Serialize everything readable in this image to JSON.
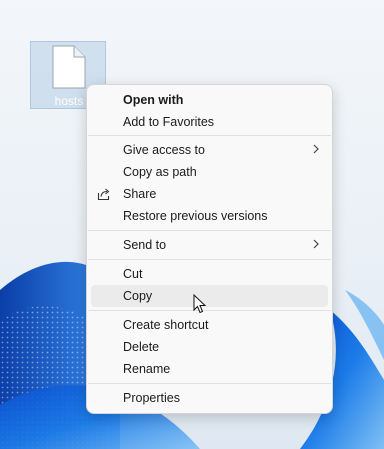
{
  "desktop": {
    "file": {
      "name": "hosts",
      "icon": "document-icon"
    }
  },
  "context_menu": {
    "items": [
      {
        "label": "Open with",
        "bold": true
      },
      {
        "label": "Add to Favorites"
      },
      {
        "label": "Give access to",
        "submenu": true
      },
      {
        "label": "Copy as path"
      },
      {
        "label": "Share",
        "icon": "share-icon"
      },
      {
        "label": "Restore previous versions"
      },
      {
        "label": "Send to",
        "submenu": true
      },
      {
        "label": "Cut"
      },
      {
        "label": "Copy",
        "hovered": true
      },
      {
        "label": "Create shortcut"
      },
      {
        "label": "Delete"
      },
      {
        "label": "Rename"
      },
      {
        "label": "Properties"
      }
    ]
  },
  "colors": {
    "menu_background": "#f9f9f9",
    "hover_background": "#ebebeb",
    "text": "#1b1b1b",
    "selection": "#b4cde6"
  }
}
